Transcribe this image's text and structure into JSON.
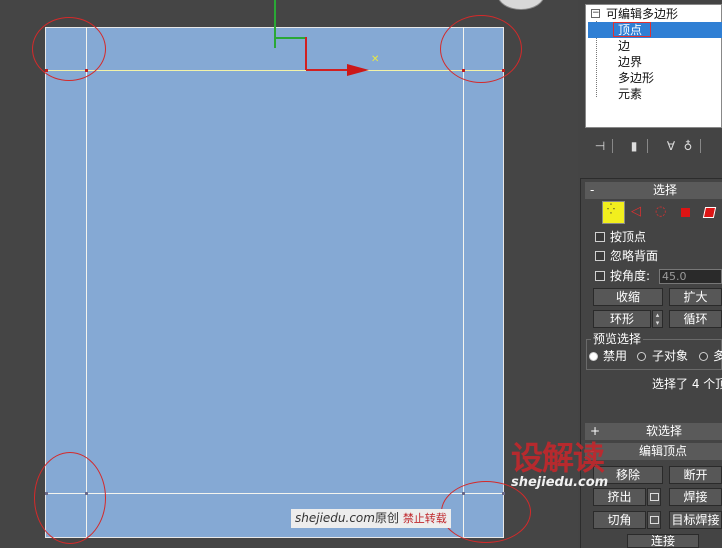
{
  "stack": {
    "root": "可编辑多边形",
    "items": [
      "顶点",
      "边",
      "边界",
      "多边形",
      "元素"
    ]
  },
  "select_rollout": {
    "title": "选择",
    "by_vertex": "按顶点",
    "ignore_backfacing": "忽略背面",
    "by_angle": "按角度:",
    "angle_value": "45.0",
    "shrink": "收缩",
    "grow": "扩大",
    "ring": "环形",
    "loop": "循环",
    "preview_group": "预览选择",
    "preview_off": "禁用",
    "preview_subobj": "子对象",
    "preview_multi": "多",
    "status": "选择了 4 个顶"
  },
  "soft_selection": {
    "sign": "+",
    "title": "软选择"
  },
  "edit_vertices": {
    "sign": "-",
    "title": "编辑顶点",
    "remove": "移除",
    "break": "断开",
    "extrude": "挤出",
    "weld": "焊接",
    "chamfer": "切角",
    "target_weld": "目标焊接",
    "connect": "连接"
  },
  "watermark": {
    "logo": "设解读",
    "logo_url": "shejiedu.com",
    "footer_site": "shejiedu.com",
    "footer_original": "原创",
    "footer_warning": "禁止转载"
  },
  "colors": {
    "viewport_bg": "#454545",
    "plane": "#85a9d4",
    "highlight": "#2f7fd4",
    "select_circle": "#d42a2a",
    "watermark_red": "#c0282d"
  }
}
